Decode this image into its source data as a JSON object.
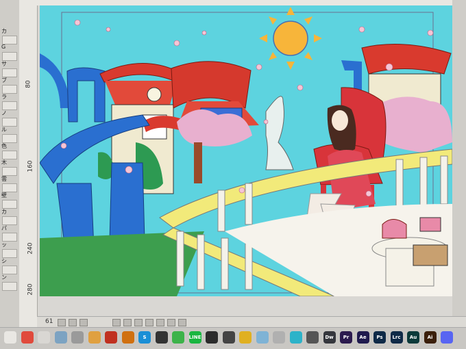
{
  "ruler": {
    "v_ticks": [
      "80",
      "160",
      "240",
      "280"
    ],
    "h_ticks": []
  },
  "left_panel": {
    "labels": [
      "カ",
      "G",
      "サ",
      "ブ",
      "ラ",
      "ノ",
      "ル",
      "色",
      "木",
      "雲",
      "壁",
      "カ",
      "パ",
      "ッ",
      "シ",
      "ン"
    ]
  },
  "canvas": {
    "description_hidden": ""
  },
  "bottom": {
    "zoom": "61"
  },
  "dock": {
    "icons": [
      {
        "name": "launchpad-icon",
        "text": "",
        "color": "#e9e7e3"
      },
      {
        "name": "chrome-icon",
        "text": "",
        "color": "#e04a3c"
      },
      {
        "name": "safari-icon",
        "text": "",
        "color": "#d9d7d3"
      },
      {
        "name": "preview-icon",
        "text": "",
        "color": "#7ca3c2"
      },
      {
        "name": "script-icon",
        "text": "",
        "color": "#9a9a9a"
      },
      {
        "name": "folder-icon",
        "text": "",
        "color": "#e0a040"
      },
      {
        "name": "game-icon",
        "text": "",
        "color": "#c03020"
      },
      {
        "name": "game2-icon",
        "text": "",
        "color": "#d07010"
      },
      {
        "name": "skype-icon",
        "text": "S",
        "color": "#1a8fd6"
      },
      {
        "name": "app-icon",
        "text": "",
        "color": "#333333"
      },
      {
        "name": "evernote-icon",
        "text": "",
        "color": "#3db34a"
      },
      {
        "name": "line-icon",
        "text": "LINE",
        "color": "#19b640"
      },
      {
        "name": "finalcut-icon",
        "text": "",
        "color": "#2c2c2c"
      },
      {
        "name": "app2-icon",
        "text": "",
        "color": "#444444"
      },
      {
        "name": "app3-icon",
        "text": "",
        "color": "#e0b020"
      },
      {
        "name": "app4-icon",
        "text": "",
        "color": "#7fb3d5"
      },
      {
        "name": "app5-icon",
        "text": "",
        "color": "#b0b0b0"
      },
      {
        "name": "app6-icon",
        "text": "",
        "color": "#2db3c9"
      },
      {
        "name": "app7-icon",
        "text": "",
        "color": "#555555"
      },
      {
        "name": "dreamweaver-icon",
        "text": "Dw",
        "color": "#35373d"
      },
      {
        "name": "premiere-icon",
        "text": "Pr",
        "color": "#2b1a4e"
      },
      {
        "name": "aftereffects-icon",
        "text": "Ae",
        "color": "#1f1a4e"
      },
      {
        "name": "photoshop-icon",
        "text": "Ps",
        "color": "#0f2a47"
      },
      {
        "name": "lightroom-icon",
        "text": "Lrc",
        "color": "#0f2a47"
      },
      {
        "name": "audition-icon",
        "text": "Au",
        "color": "#0b3a3a"
      },
      {
        "name": "illustrator-icon",
        "text": "Ai",
        "color": "#3b1f0b"
      },
      {
        "name": "discord-icon",
        "text": "",
        "color": "#5865f2"
      }
    ]
  }
}
